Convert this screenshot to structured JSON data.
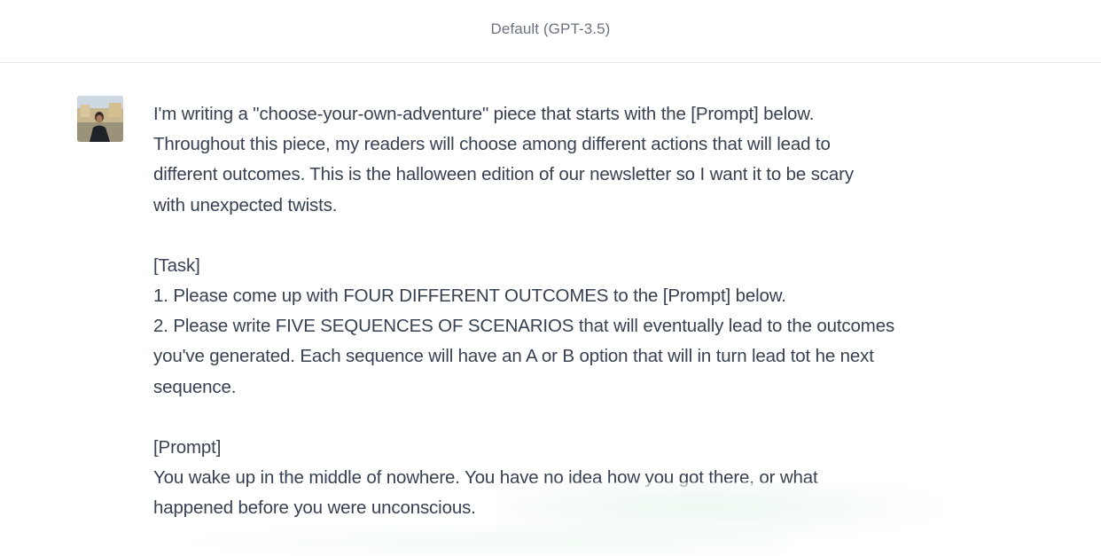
{
  "header": {
    "model_label": "Default (GPT-3.5)"
  },
  "message": {
    "avatar_icon": "user-avatar-photo",
    "intro_lines": [
      "I'm writing a \"choose-your-own-adventure\" piece that starts with the [Prompt] below.",
      "Throughout this piece, my readers will choose among different actions that will lead to",
      "different outcomes. This is the halloween edition of our newsletter so I want it to be scary",
      "with unexpected twists."
    ],
    "task_lines": [
      "[Task]",
      "1. Please come up with FOUR DIFFERENT OUTCOMES to the [Prompt] below.",
      "2. Please write FIVE SEQUENCES OF SCENARIOS that will eventually lead to the outcomes",
      "you've generated. Each sequence will have an A or B option that will in turn lead tot he next",
      "sequence."
    ],
    "prompt_lines": [
      "[Prompt]",
      "You wake up in the middle of nowhere.  You have no idea how you got there, or what",
      "happened before you were unconscious."
    ]
  }
}
